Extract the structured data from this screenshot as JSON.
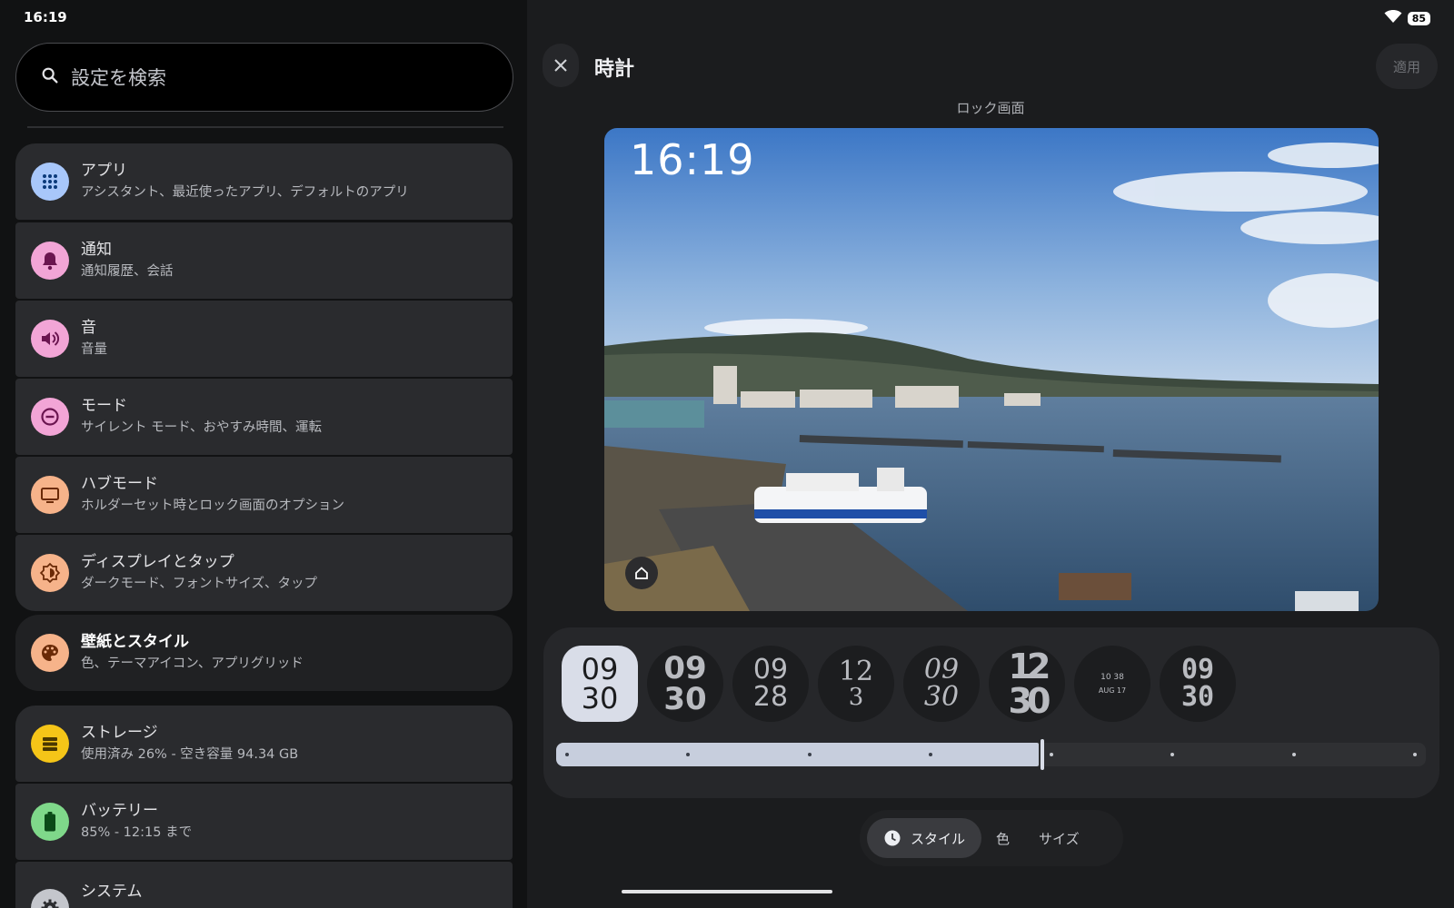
{
  "status": {
    "time": "16:19",
    "battery": "85"
  },
  "search": {
    "placeholder": "設定を検索"
  },
  "settings": {
    "items": [
      {
        "title": "アプリ",
        "subtitle": "アシスタント、最近使ったアプリ、デフォルトのアプリ",
        "icon": "apps-grid-icon",
        "color": "#a8c7fa"
      },
      {
        "title": "通知",
        "subtitle": "通知履歴、会話",
        "icon": "bell-icon",
        "color": "#f2a5d6"
      },
      {
        "title": "音",
        "subtitle": "音量",
        "icon": "speaker-icon",
        "color": "#f2a5d6"
      },
      {
        "title": "モード",
        "subtitle": "サイレント モード、おやすみ時間、運転",
        "icon": "do-not-disturb-icon",
        "color": "#f2a5d6"
      },
      {
        "title": "ハブモード",
        "subtitle": "ホルダーセット時とロック画面のオプション",
        "icon": "monitor-icon",
        "color": "#f6b38a"
      },
      {
        "title": "ディスプレイとタップ",
        "subtitle": "ダークモード、フォントサイズ、タップ",
        "icon": "brightness-icon",
        "color": "#f6b38a"
      },
      {
        "title": "壁紙とスタイル",
        "subtitle": "色、テーマアイコン、アプリグリッド",
        "icon": "palette-icon",
        "color": "#f6b38a",
        "selected": true
      },
      {
        "title": "ストレージ",
        "subtitle": "使用済み 26% - 空き容量 94.34 GB",
        "icon": "storage-icon",
        "color": "#f5c518"
      },
      {
        "title": "バッテリー",
        "subtitle": "85% - 12:15 まで",
        "icon": "battery-icon",
        "color": "#7fd88a"
      },
      {
        "title": "システム",
        "subtitle": "",
        "icon": "gear-icon",
        "color": "#c4c6cc"
      }
    ]
  },
  "editor": {
    "title": "時計",
    "apply_label": "適用",
    "preview_label": "ロック画面",
    "preview_clock": "16:19"
  },
  "clock_faces": [
    {
      "line1": "09",
      "line2": "30",
      "selected": true
    },
    {
      "line1": "09",
      "line2": "30"
    },
    {
      "line1": "09",
      "line2": "28"
    },
    {
      "line1": "12",
      "line2": "3"
    },
    {
      "line1": "09",
      "line2": "30"
    },
    {
      "line1": "12",
      "line2": "30"
    },
    {
      "line1": "10 38",
      "line2": "AUG 17"
    },
    {
      "line1": "09",
      "line2": "30"
    }
  ],
  "size_slider": {
    "value_fraction": 0.555,
    "steps": 8
  },
  "tabs": [
    {
      "label": "スタイル",
      "active": true
    },
    {
      "label": "色"
    },
    {
      "label": "サイズ"
    }
  ]
}
